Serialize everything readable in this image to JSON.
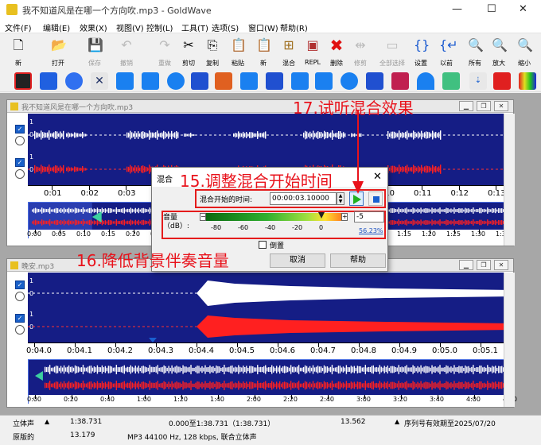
{
  "window": {
    "title": "我不知道风是在哪一个方向吹.mp3 - GoldWave"
  },
  "menu": [
    "文件(F)",
    "编辑(E)",
    "效果(X)",
    "视图(V)",
    "控制(L)",
    "工具(T)",
    "选项(S)",
    "窗口(W)",
    "帮助(R)"
  ],
  "toolbar1": [
    {
      "label": "新",
      "icon": "new-file-icon",
      "enabled": true
    },
    {
      "label": "打开",
      "icon": "open-folder-icon",
      "enabled": true
    },
    {
      "label": "保存",
      "icon": "save-icon",
      "enabled": false
    },
    {
      "label": "撤销",
      "icon": "undo-icon",
      "enabled": false
    },
    {
      "label": "重做",
      "icon": "redo-icon",
      "enabled": false
    },
    {
      "label": "剪切",
      "icon": "cut-icon",
      "enabled": true
    },
    {
      "label": "复制",
      "icon": "copy-icon",
      "enabled": true
    },
    {
      "label": "粘贴",
      "icon": "paste-icon",
      "enabled": true
    },
    {
      "label": "新",
      "icon": "paste-new-icon",
      "enabled": true
    },
    {
      "label": "混合",
      "icon": "mix-icon",
      "enabled": true
    },
    {
      "label": "REPL",
      "icon": "replace-icon",
      "enabled": true
    },
    {
      "label": "删除",
      "icon": "delete-icon",
      "enabled": true
    },
    {
      "label": "修剪",
      "icon": "trim-icon",
      "enabled": false
    },
    {
      "label": "全部选择",
      "icon": "select-all-icon",
      "enabled": false
    },
    {
      "label": "设置",
      "icon": "set-marker-icon",
      "enabled": true
    },
    {
      "label": "以前",
      "icon": "previous-icon",
      "enabled": true
    },
    {
      "label": "所有",
      "icon": "zoom-all-icon",
      "enabled": true
    },
    {
      "label": "放大",
      "icon": "zoom-in-icon",
      "enabled": true
    },
    {
      "label": "缩小",
      "icon": "zoom-out-icon",
      "enabled": true
    }
  ],
  "doc1": {
    "title": "我不知道风是在哪一个方向吹.mp3",
    "ruler": [
      "0:01",
      "0:02",
      "0:03",
      "0:04",
      "0:05",
      "0:06",
      "0:07",
      "0:08",
      "0:09",
      "0:10",
      "0:11",
      "0:12",
      "0:13"
    ],
    "overview_ruler": [
      "0:00",
      "0:05",
      "0:10",
      "0:15",
      "0:20",
      "0:25",
      "0:30",
      "0:35",
      "0:40",
      "0:45",
      "0:50",
      "0:55",
      "1:00",
      "1:05",
      "1:10",
      "1:15",
      "1:20",
      "1:25",
      "1:30",
      "1:35"
    ]
  },
  "doc2": {
    "title": "晚安.mp3",
    "ruler": [
      "0:04.0",
      "0:04.1",
      "0:04.2",
      "0:04.3",
      "0:04.4",
      "0:04.5",
      "0:04.6",
      "0:04.7",
      "0:04.8",
      "0:04.9",
      "0:05.0",
      "0:05.1"
    ],
    "overview_ruler": [
      "0:00",
      "0:20",
      "0:40",
      "1:00",
      "1:20",
      "1:40",
      "2:00",
      "2:20",
      "2:40",
      "3:00",
      "3:20",
      "3:40",
      "4:00",
      "4:20"
    ]
  },
  "channel_scale": {
    "top": "1",
    "mid": "0"
  },
  "dialog": {
    "title": "混合",
    "start_label": "混合开始的时间:",
    "start_value": "00:00:03.10000",
    "volume_label": "音量（dB）:",
    "volume_value": "-5",
    "volume_percent": "56.23%",
    "scale": [
      "-80",
      "-60",
      "-40",
      "-20",
      "0"
    ],
    "volume_level_db": -5,
    "reverse_label": "倒置",
    "cancel_label": "取消",
    "help_label": "帮助"
  },
  "annotations": {
    "a15": "15.调整混合开始时间",
    "a16": "16.降低背景伴奏音量",
    "a17": "17.试听混合效果"
  },
  "status": {
    "channel": "立体声",
    "length": "1:38.731",
    "selection": "0.000至1:38.731（1:38.731）",
    "position": "13.562",
    "reg": "序列号有效期至2025/07/20",
    "row2_label": "原版的",
    "row2_value": "13.179",
    "format": "MP3 44100 Hz, 128 kbps, 联合立体声"
  },
  "colors": {
    "wave_bg": "#151d85",
    "white_wave": "#ffffff",
    "red_wave": "#ff2020",
    "annotation": "#e8121b"
  }
}
